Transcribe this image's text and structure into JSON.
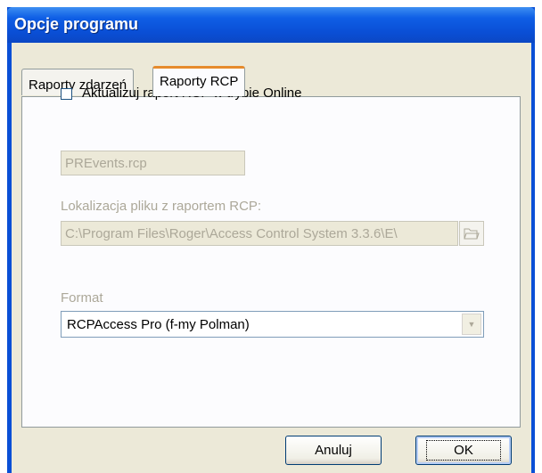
{
  "window": {
    "title": "Opcje programu"
  },
  "tabs": [
    {
      "label": "Raporty zdarzeń",
      "active": false
    },
    {
      "label": "Raporty RCP",
      "active": true
    }
  ],
  "online_report": {
    "label": "Aktualizuj raport RCP w trybie Online",
    "checked": false
  },
  "file_name": {
    "value": "PREvents.rcp"
  },
  "location": {
    "label": "Lokalizacja pliku z raportem RCP:",
    "value": "C:\\Program Files\\Roger\\Access Control System 3.3.6\\E\\"
  },
  "format": {
    "label": "Format",
    "selected": "RCPAccess Pro (f-my Polman)"
  },
  "buttons": {
    "cancel": "Anuluj",
    "ok": "OK"
  },
  "icons": {
    "browse": "folder-open-icon",
    "dropdown": "chevron-down-icon"
  }
}
